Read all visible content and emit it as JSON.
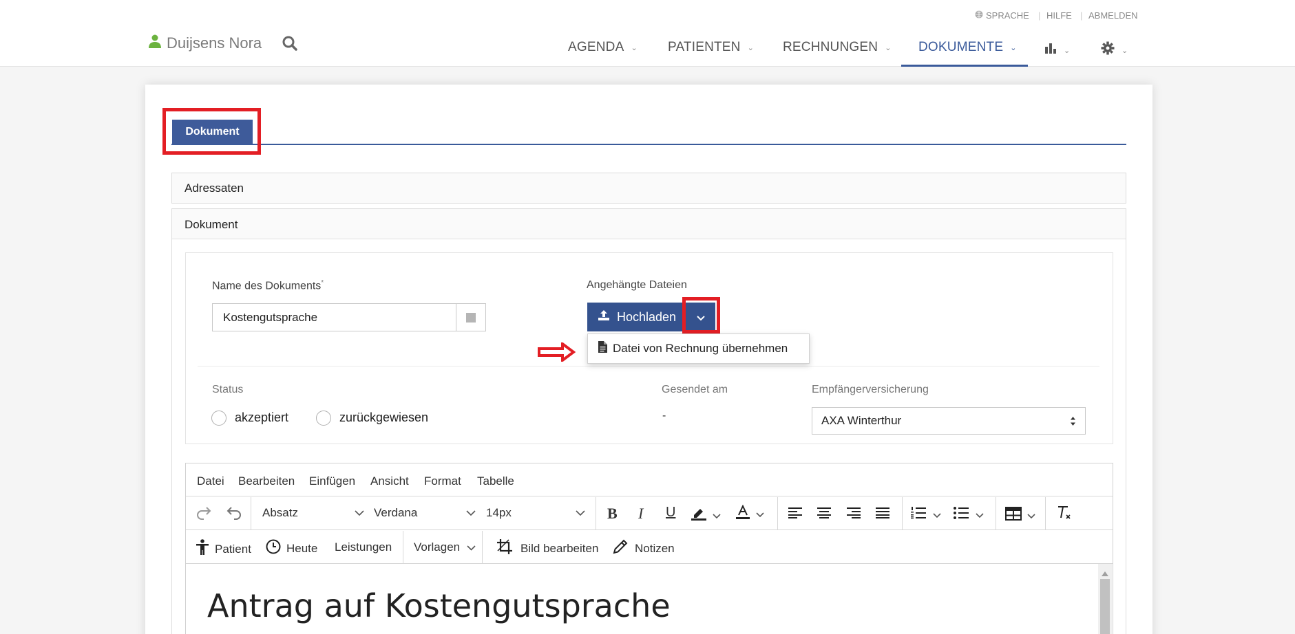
{
  "header": {
    "utility": {
      "language": "SPRACHE",
      "help": "HILFE",
      "logout": "ABMELDEN"
    },
    "user_name": "Duijsens Nora",
    "nav": [
      {
        "label": "AGENDA"
      },
      {
        "label": "PATIENTEN"
      },
      {
        "label": "RECHNUNGEN"
      },
      {
        "label": "DOKUMENTE",
        "active": true
      }
    ],
    "accent_color": "#3a5a9a"
  },
  "tab": {
    "label": "Dokument"
  },
  "sections": {
    "addressees": "Adressaten",
    "document": "Dokument"
  },
  "form": {
    "name_label": "Name des Dokuments",
    "name_required_mark": "*",
    "name_value": "Kostengutsprache",
    "attachments_label": "Angehängte Dateien",
    "upload_label": "Hochladen",
    "dropdown_item": "Datei von Rechnung übernehmen",
    "status_label": "Status",
    "status_options": [
      "akzeptiert",
      "zurückgewiesen"
    ],
    "sent_label": "Gesendet am",
    "sent_value": "-",
    "insurer_label": "Empfängerversicherung",
    "insurer_value": "AXA Winterthur"
  },
  "editor": {
    "menu": [
      "Datei",
      "Bearbeiten",
      "Einfügen",
      "Ansicht",
      "Format",
      "Tabelle"
    ],
    "block_format": "Absatz",
    "font_family": "Verdana",
    "font_size": "14px",
    "toolbar2": {
      "patient": "Patient",
      "today": "Heute",
      "services": "Leistungen",
      "templates": "Vorlagen",
      "edit_image": "Bild bearbeiten",
      "notes": "Notizen"
    },
    "content_heading": "Antrag auf Kostengutsprache"
  },
  "highlight_color": "#e31e24"
}
